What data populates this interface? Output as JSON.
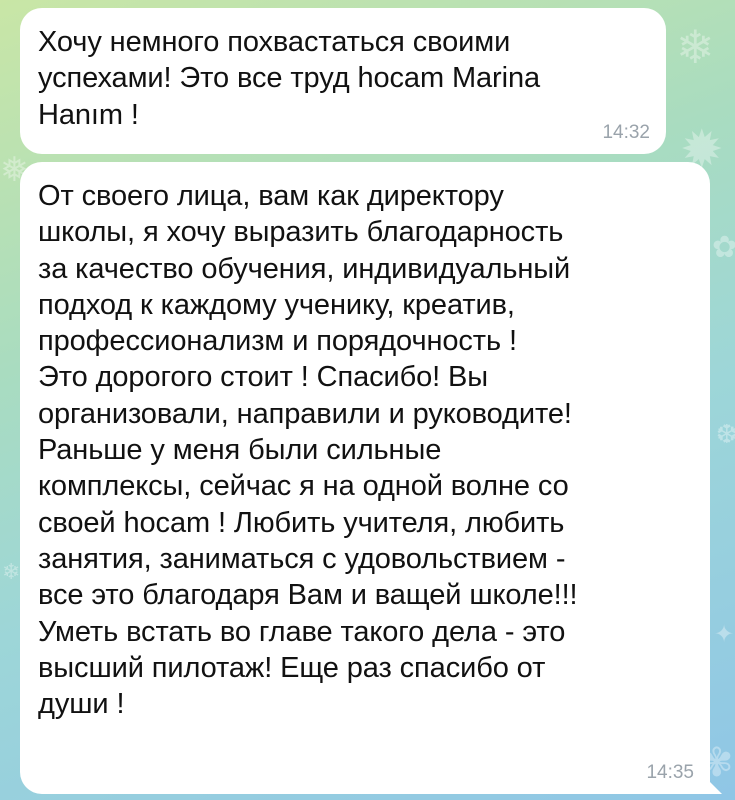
{
  "chat": {
    "background_colors": [
      "#c9e6a6",
      "#9dd6d8",
      "#8fc6e6"
    ],
    "bubble_color": "#ffffff",
    "messages": [
      {
        "text": "Хочу немного похвастаться своими\nуспехами! Это все труд hocam Marina\nHanım !",
        "time": "14:32"
      },
      {
        "text": "От своего лица, вам как директору\nшколы, я хочу выразить благодарность\nза качество обучения, индивидуальный\nподход к каждому ученику, креатив,\nпрофессионализм  и порядочность !\nЭто дорогого стоит ! Спасибо! Вы\nорганизовали, направили и руководите!\nРаньше у меня были сильные\nкомплексы, сейчас я на одной волне со\nсвоей  hocam ! Любить учителя, любить\nзанятия, заниматься с удовольствием -\nвсе это благодаря Вам и ващей школе!!!\nУметь встать во главе такого дела - это\nвысший пилотаж! Еще раз спасибо от\nдуши !",
        "time": "14:35"
      }
    ]
  }
}
